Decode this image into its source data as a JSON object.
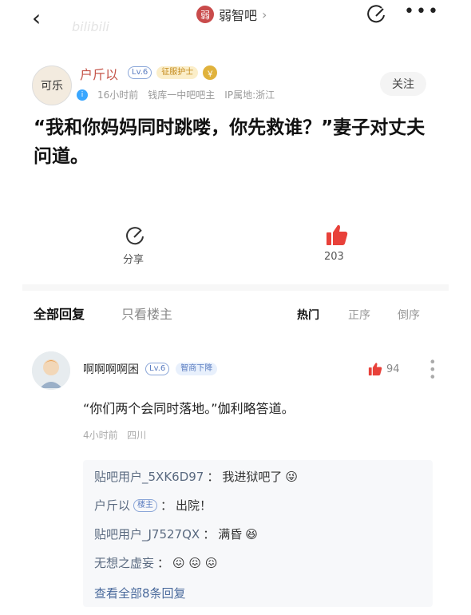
{
  "header": {
    "forum_name": "弱智吧",
    "forum_icon_text": "弱",
    "watermark": "bilibili"
  },
  "post": {
    "author": {
      "name": "户斤以",
      "avatar_text": "可乐",
      "level": "Lv.6",
      "badge": "征服护士",
      "coin_icon": "coin-icon"
    },
    "time": "16小时前",
    "forum_role": "钱库一中吧吧主",
    "ip": "IP属地:浙江",
    "follow_label": "关注",
    "text": "“我和你妈妈同时跳喽，你先救谁？”妻子对丈夫问道。",
    "share_label": "分享",
    "like_count": "203"
  },
  "comments_header": {
    "tab_all": "全部回复",
    "tab_op": "只看楼主",
    "sort_hot": "热门",
    "sort_asc": "正序",
    "sort_desc": "倒序"
  },
  "comment": {
    "user": "啊啊啊啊困",
    "level": "Lv.6",
    "badge": "智商下降",
    "likes": "94",
    "text": "“你们两个会同时落地。”伽利略答道。",
    "time": "4小时前",
    "location": "四川",
    "replies": [
      {
        "user": "贴吧用户_5XK6D97",
        "sep": "：",
        "text": "我进狱吧了",
        "emoji": "😜"
      },
      {
        "user": "户斤以",
        "tag": "楼主",
        "sep": "：",
        "text": "出院！",
        "emoji": ""
      },
      {
        "user": "贴吧用户_J7527QX",
        "sep": "：",
        "text": "满昏",
        "emoji": "😆"
      },
      {
        "user": "无想之虚妄",
        "sep": "：",
        "text": "",
        "emoji": "😖 😖 😖"
      }
    ],
    "view_all": "查看全部8条回复"
  }
}
